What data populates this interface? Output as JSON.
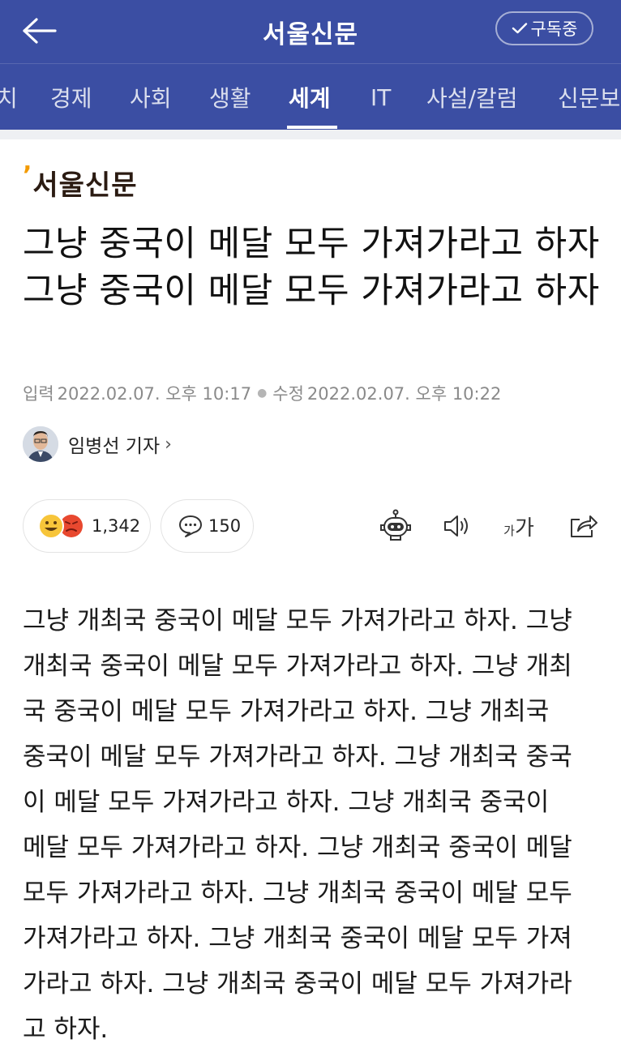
{
  "header": {
    "back_icon": "arrow-left-icon",
    "title": "서울신문",
    "subscribe_label": "구독중",
    "subscribe_icon": "check-icon",
    "background": "#3b4ea3"
  },
  "tabs": [
    {
      "label": "치"
    },
    {
      "label": "경제"
    },
    {
      "label": "사회"
    },
    {
      "label": "생활"
    },
    {
      "label": "세계",
      "active": true
    },
    {
      "label": "IT"
    },
    {
      "label": "사설/칼럼"
    },
    {
      "label": "신문보"
    }
  ],
  "article": {
    "press_name": "서울신문",
    "press_mark": "’",
    "headline": "그냥 중국이 메달 모두 가져가라고 하자 그냥 중국이 메달 모두 가져가라고 하자",
    "input_label": "입력",
    "input_time": "2022.02.07. 오후 10:17",
    "modified_label": "수정",
    "modified_time": "2022.02.07. 오후 10:22",
    "reporter": "임병선 기자",
    "reaction_count": "1,342",
    "comment_count": "150",
    "body": "그냥 개최국 중국이 메달 모두 가져가라고 하자. 그냥 개최국 중국이 메달 모두 가져가라고 하자. 그냥 개최국 중국이 메달 모두 가져가라고 하자. 그냥 개최국 중국이 메달 모두 가져가라고 하자. 그냥 개최국 중국이 메달 모두 가져가라고 하자. 그냥 개최국 중국이 메달 모두 가져가라고 하자. 그냥 개최국 중국이 메달 모두 가져가라고 하자. 그냥 개최국 중국이 메달 모두 가져가라고 하자. 그냥 개최국 중국이 메달 모두 가져가라고 하자. 그냥 개최국 중국이 메달 모두 가져가라고 하자."
  },
  "toolbar": {
    "robot_icon": "summary-bot-icon",
    "speaker_icon": "speaker-icon",
    "font_size_label": "가가",
    "share_icon": "share-icon"
  }
}
